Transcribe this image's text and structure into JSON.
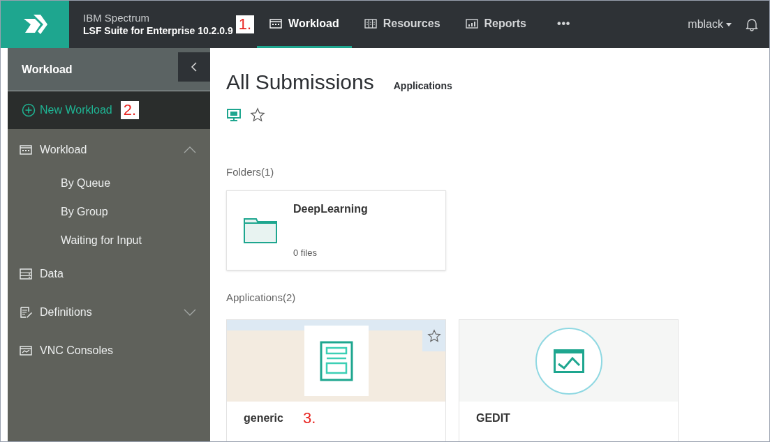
{
  "header": {
    "brand_line1": "IBM Spectrum",
    "brand_line2": "LSF Suite for Enterprise 10.2.0.9",
    "callout": "1.",
    "nav": [
      {
        "label": "Workload",
        "kind": "calendar",
        "selected": true
      },
      {
        "label": "Resources",
        "kind": "grid",
        "selected": false
      },
      {
        "label": "Reports",
        "kind": "chart",
        "selected": false
      },
      {
        "label": "•••",
        "kind": "more",
        "selected": false
      }
    ],
    "user": "mblack"
  },
  "sidebar": {
    "title": "Workload",
    "new_workload": {
      "label": "New Workload",
      "callout": "2."
    },
    "items": [
      {
        "label": "Workload",
        "kind": "calendar",
        "expanded": true,
        "children": [
          {
            "label": "By Queue"
          },
          {
            "label": "By Group"
          },
          {
            "label": "Waiting for Input"
          }
        ]
      },
      {
        "label": "Data",
        "kind": "server"
      },
      {
        "label": "Definitions",
        "kind": "edit",
        "expanded": false
      },
      {
        "label": "VNC Consoles",
        "kind": "monitor"
      }
    ]
  },
  "main": {
    "title": "All Submissions",
    "subtitle": "Applications",
    "folders_label": "Folders(1)",
    "folders": [
      {
        "name": "DeepLearning",
        "count": "0 files"
      }
    ],
    "applications_label": "Applications(2)",
    "applications": [
      {
        "name": "generic",
        "kind": "form",
        "hovered": true,
        "callout": "3."
      },
      {
        "name": "GEDIT",
        "kind": "monitor",
        "hovered": false
      }
    ]
  }
}
